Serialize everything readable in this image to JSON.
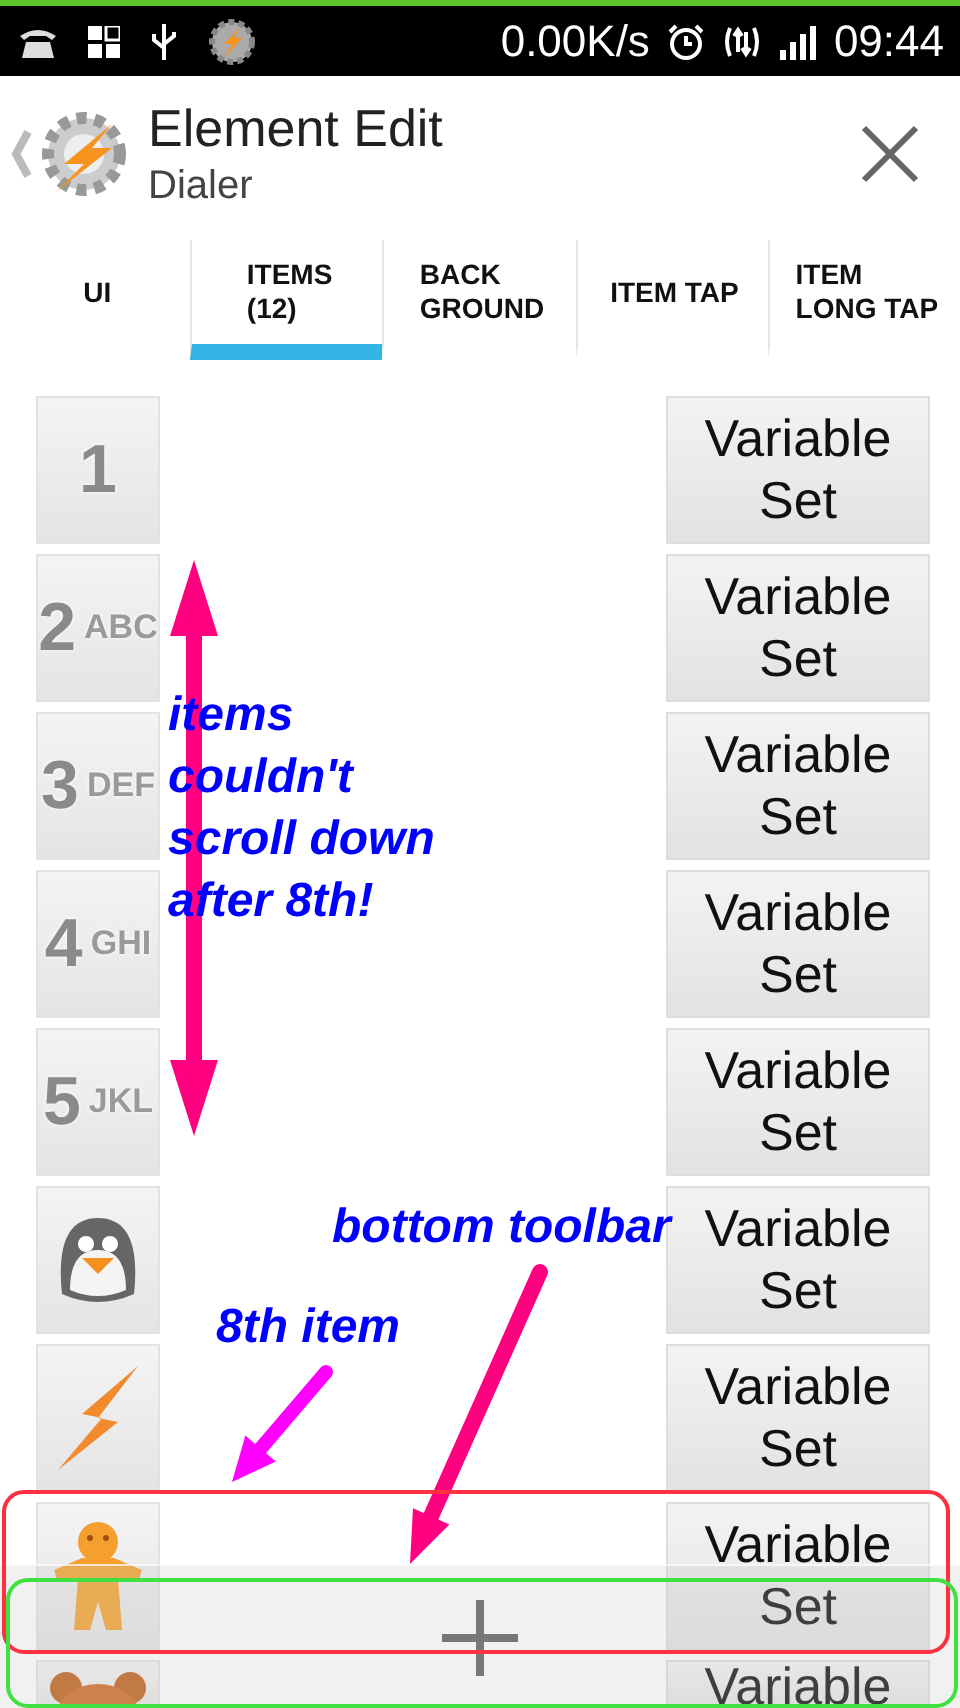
{
  "status_bar": {
    "speed": "0.00K/s",
    "time": "09:44"
  },
  "header": {
    "title": "Element Edit",
    "subtitle": "Dialer"
  },
  "tabs": [
    {
      "label": "UI",
      "selected": false
    },
    {
      "label": "ITEMS\n(12)",
      "selected": true
    },
    {
      "label": "BACK\nGROUND",
      "selected": false
    },
    {
      "label": "ITEM TAP",
      "selected": false
    },
    {
      "label": "ITEM\nLONG TAP",
      "selected": false
    }
  ],
  "items": [
    {
      "kind": "keypad",
      "digit": "1",
      "button": "Variable\nSet"
    },
    {
      "kind": "keypad",
      "digit": "2",
      "letters": "ABC",
      "button": "Variable\nSet"
    },
    {
      "kind": "keypad",
      "digit": "3",
      "letters": "DEF",
      "button": "Variable\nSet"
    },
    {
      "kind": "keypad",
      "digit": "4",
      "letters": "GHI",
      "button": "Variable\nSet"
    },
    {
      "kind": "keypad",
      "digit": "5",
      "letters": "JKL",
      "button": "Variable\nSet"
    },
    {
      "kind": "penguin",
      "button": "Variable\nSet"
    },
    {
      "kind": "bolt",
      "button": "Variable\nSet"
    },
    {
      "kind": "gingerbread",
      "button": "Variable\nSet"
    },
    {
      "kind": "bear",
      "button": "Variable"
    }
  ],
  "annotations": [
    {
      "text": "items couldn't scroll down after 8th!"
    },
    {
      "text": "bottom toolbar"
    },
    {
      "text": "8th item"
    }
  ]
}
